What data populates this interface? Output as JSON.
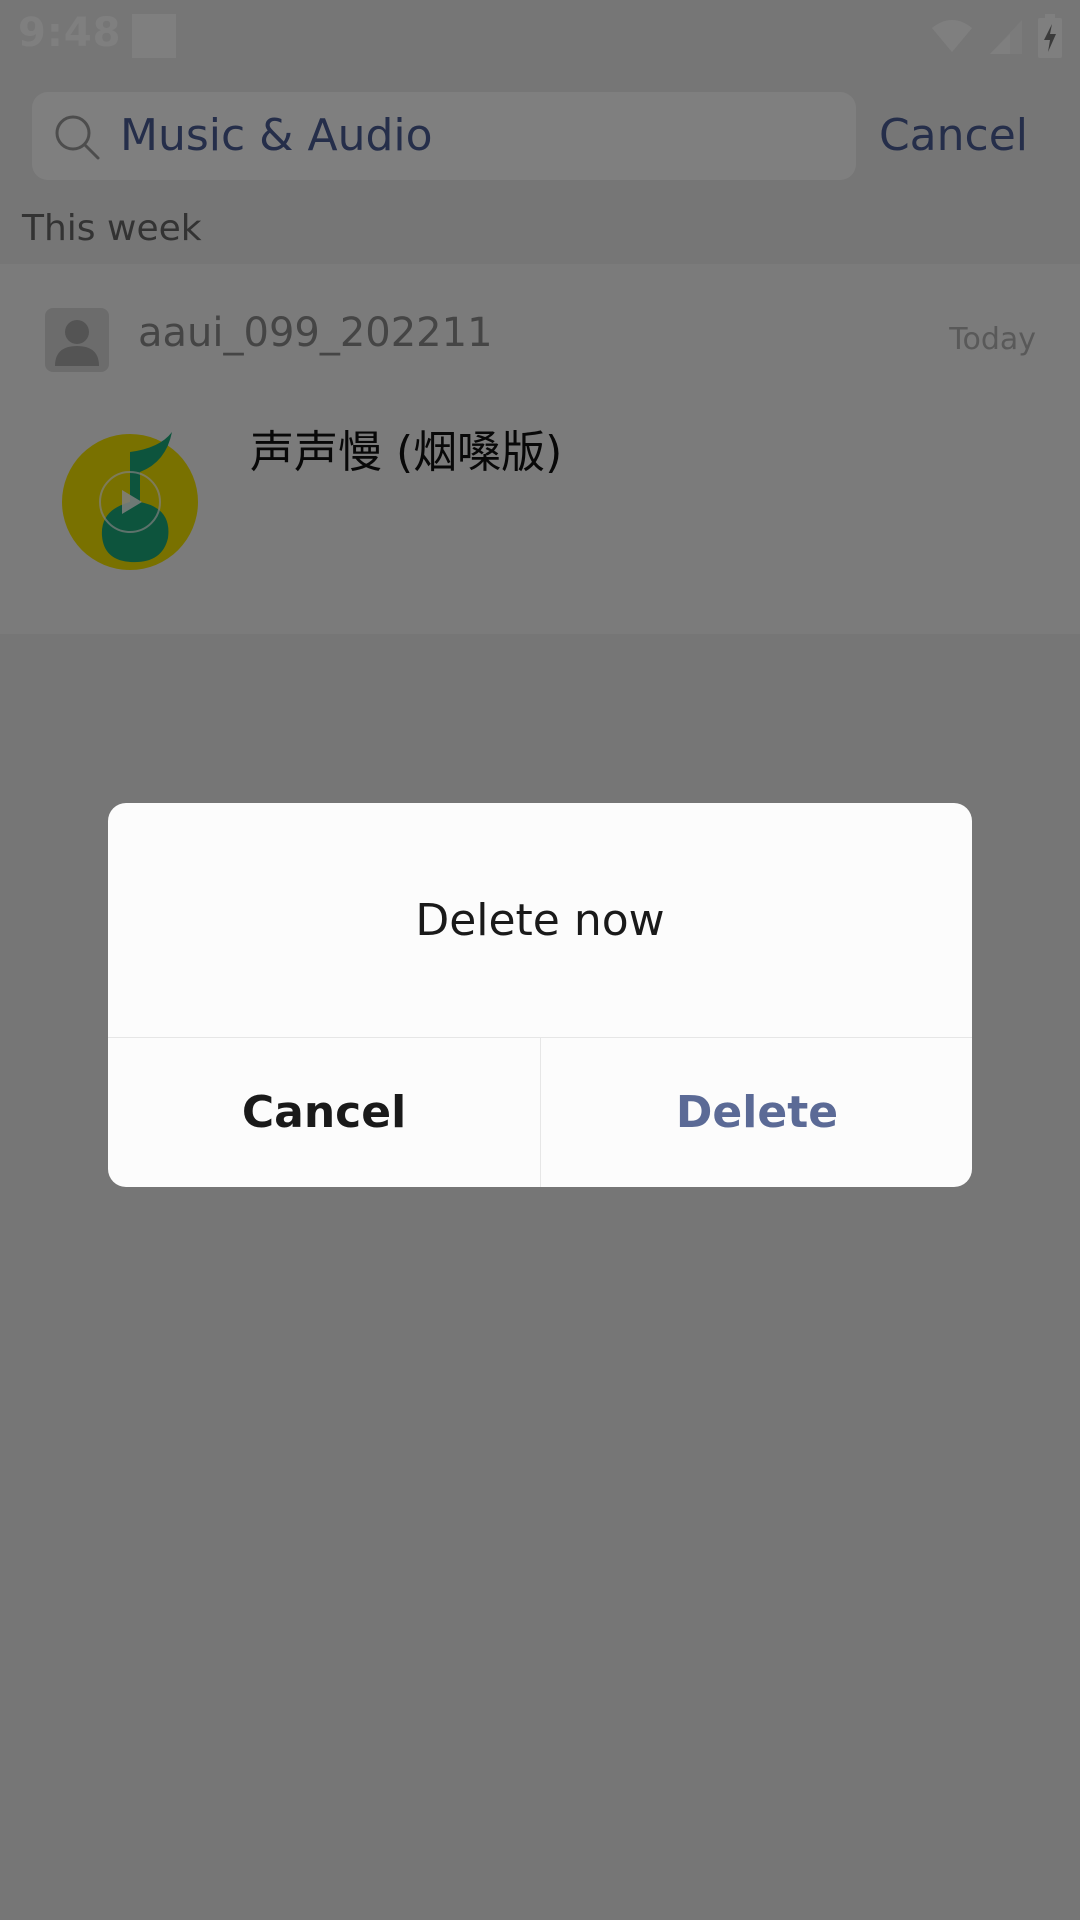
{
  "status_bar": {
    "time": "9:48"
  },
  "search": {
    "query": "Music & Audio",
    "cancel_label": "Cancel"
  },
  "section": {
    "label": "This week"
  },
  "result": {
    "sender": "aaui_099_202211",
    "date": "Today",
    "title": "声声慢 (烟嗓版)",
    "thumb_icon": "music-app-icon"
  },
  "dialog": {
    "message": "Delete now",
    "cancel_label": "Cancel",
    "delete_label": "Delete",
    "delete_color": "#5b6a96"
  },
  "colors": {
    "accent": "#4a5d95",
    "scrim": "rgba(0,0,0,0.5)"
  }
}
